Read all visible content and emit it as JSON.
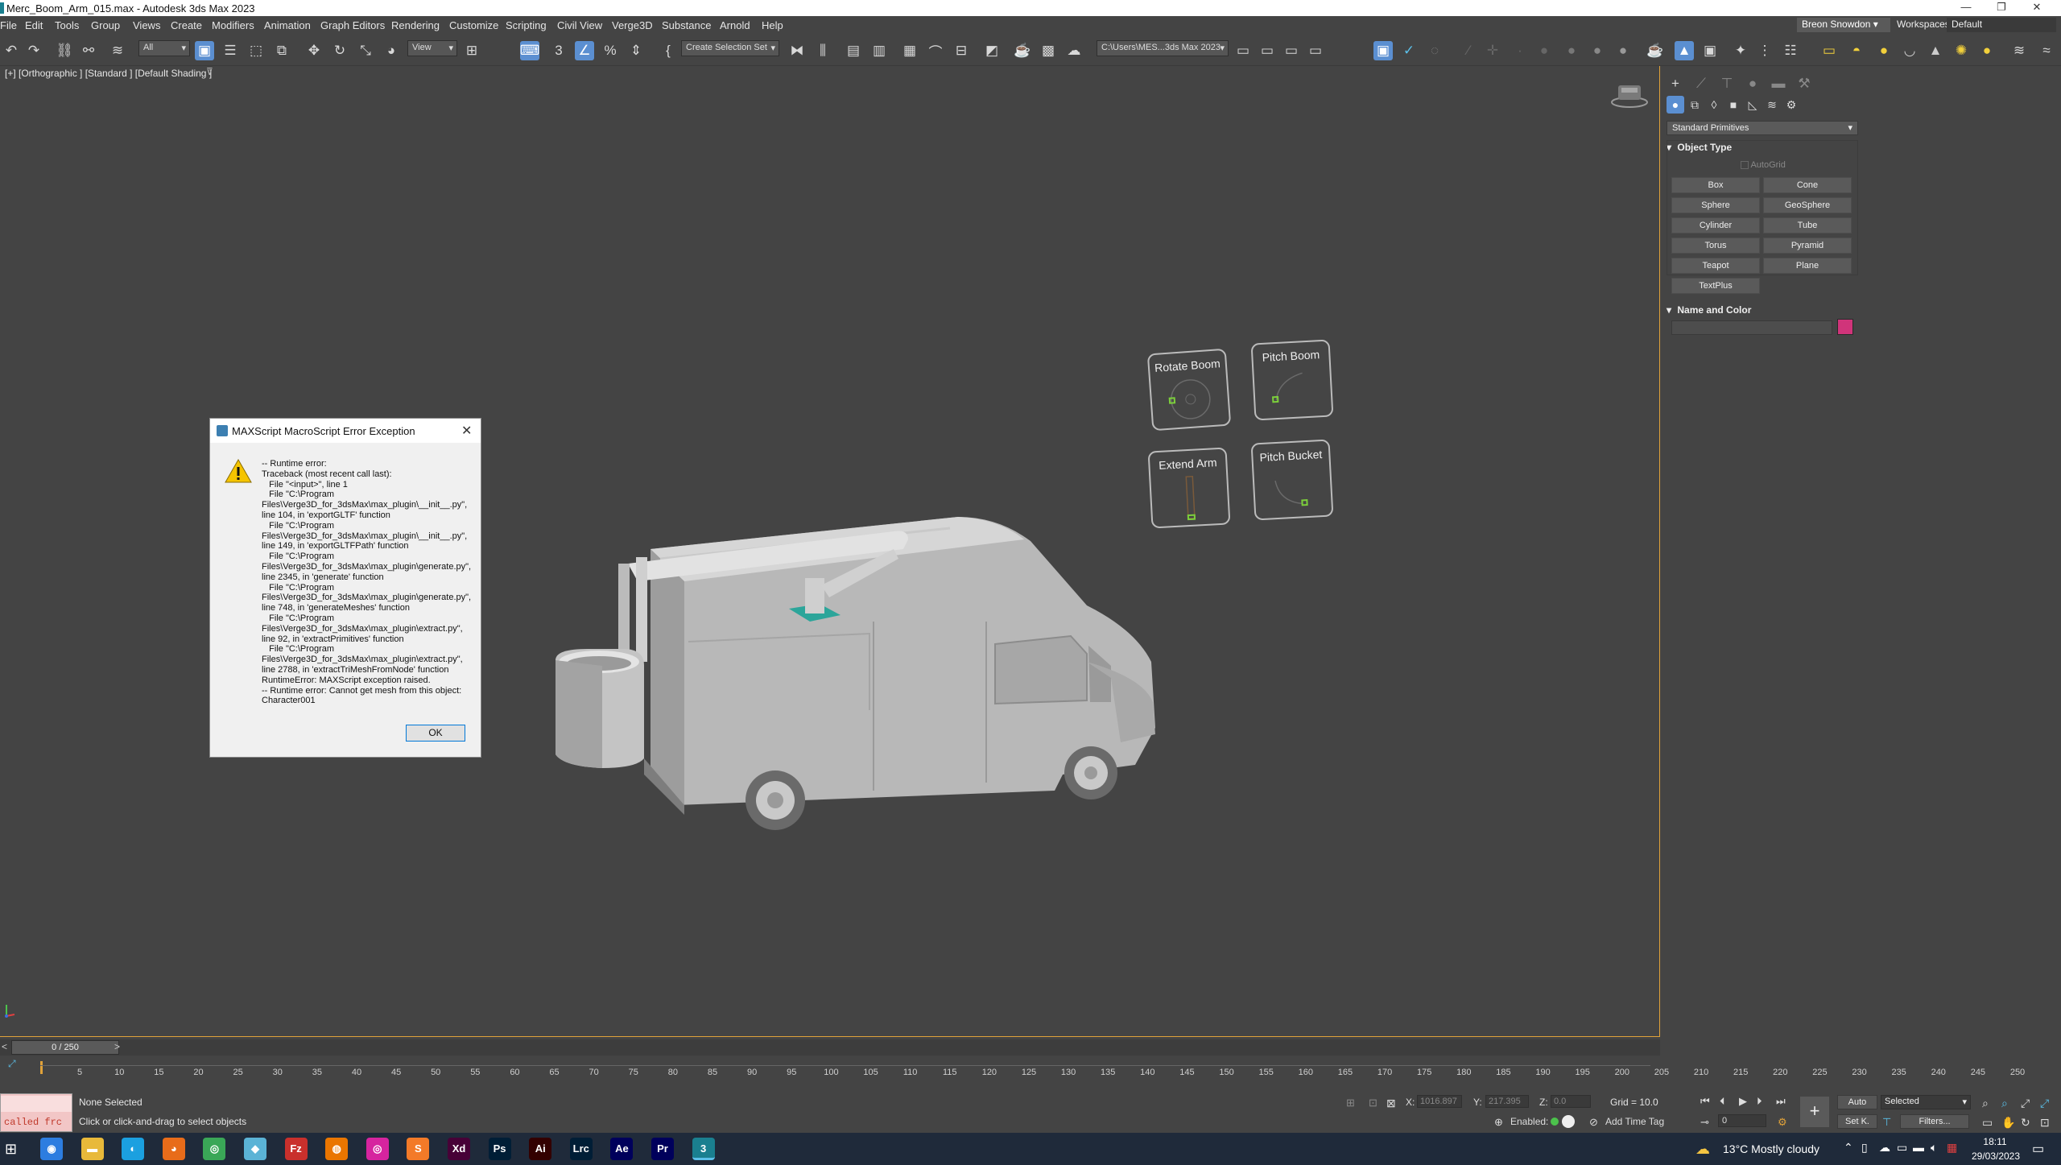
{
  "window": {
    "title": "Merc_Boom_Arm_015.max - Autodesk 3ds Max 2023"
  },
  "menu": {
    "items": [
      "File",
      "Edit",
      "Tools",
      "Group",
      "Views",
      "Create",
      "Modifiers",
      "Animation",
      "Graph Editors",
      "Rendering",
      "Customize",
      "Scripting",
      "Civil View",
      "Verge3D",
      "Substance",
      "Arnold",
      "Help"
    ],
    "user": "Breon Snowdon ▾",
    "workspaces_label": "Workspaces:",
    "workspace_value": "Default"
  },
  "toolbar": {
    "filter_value": "All",
    "ref_coord_value": "View",
    "selection_set_placeholder": "Create Selection Set",
    "project_path": "C:\\Users\\MES...3ds Max 2023"
  },
  "viewport": {
    "label": "[+] [Orthographic ] [Standard ] [Default Shading ]",
    "filter_icon": "funnel-icon"
  },
  "controls": {
    "rotate_boom": "Rotate Boom",
    "pitch_boom": "Pitch Boom",
    "extend_arm": "Extend Arm",
    "pitch_bucket": "Pitch Bucket"
  },
  "dialog": {
    "title": "MAXScript MacroScript Error Exception",
    "message": "-- Runtime error:\nTraceback (most recent call last):\n   File \"<input>\", line 1\n   File \"C:\\Program Files\\Verge3D_for_3dsMax\\max_plugin\\__init__.py\", line 104, in 'exportGLTF' function\n   File \"C:\\Program Files\\Verge3D_for_3dsMax\\max_plugin\\__init__.py\", line 149, in 'exportGLTFPath' function\n   File \"C:\\Program Files\\Verge3D_for_3dsMax\\max_plugin\\generate.py\", line 2345, in 'generate' function\n   File \"C:\\Program Files\\Verge3D_for_3dsMax\\max_plugin\\generate.py\", line 748, in 'generateMeshes' function\n   File \"C:\\Program Files\\Verge3D_for_3dsMax\\max_plugin\\extract.py\", line 92, in 'extractPrimitives' function\n   File \"C:\\Program Files\\Verge3D_for_3dsMax\\max_plugin\\extract.py\", line 2788, in 'extractTriMeshFromNode' function\nRuntimeError: MAXScript exception raised.\n-- Runtime error: Cannot get mesh from this object: Character001",
    "ok_label": "OK"
  },
  "command_panel": {
    "category_dropdown": "Standard Primitives",
    "object_type_header": "Object Type",
    "autogrid_label": "AutoGrid",
    "primitives": [
      "Box",
      "Cone",
      "Sphere",
      "GeoSphere",
      "Cylinder",
      "Tube",
      "Torus",
      "Pyramid",
      "Teapot",
      "Plane",
      "TextPlus"
    ],
    "name_color_header": "Name and Color",
    "object_color": "#d0347a"
  },
  "timeline": {
    "frame_display": "0 / 250",
    "ticks": [
      "5",
      "10",
      "15",
      "20",
      "25",
      "30",
      "35",
      "40",
      "45",
      "50",
      "55",
      "60",
      "65",
      "70",
      "75",
      "80",
      "85",
      "90",
      "95",
      "100",
      "105",
      "110",
      "115",
      "120",
      "125",
      "130",
      "135",
      "140",
      "145",
      "150",
      "155",
      "160",
      "165",
      "170",
      "175",
      "180",
      "185",
      "190",
      "195",
      "200",
      "205",
      "210",
      "215",
      "220",
      "225",
      "230",
      "235",
      "240",
      "245",
      "250"
    ]
  },
  "status": {
    "selection": "None Selected",
    "prompt": "Click or click-and-drag to select objects",
    "listener_text": "called frc",
    "x_label": "X:",
    "x_value": "1016.897",
    "y_label": "Y:",
    "y_value": "217.395",
    "z_label": "Z:",
    "z_value": "0.0",
    "grid": "Grid = 10.0",
    "enabled_label": "Enabled:",
    "add_time_tag": "Add Time Tag",
    "auto_label": "Auto",
    "selected_dropdown": "Selected",
    "set_key_label": "Set K.",
    "filters_label": "Filters...",
    "frame_input": "0"
  },
  "taskbar": {
    "apps": [
      {
        "name": "chrome-canary",
        "glyph": "◉",
        "color": "#2d7de0"
      },
      {
        "name": "file-explorer",
        "glyph": "▬",
        "color": "#e8b93a"
      },
      {
        "name": "edge",
        "glyph": "◐",
        "color": "#1ba0e0"
      },
      {
        "name": "firefox",
        "glyph": "◕",
        "color": "#e86c1a"
      },
      {
        "name": "chrome",
        "glyph": "◎",
        "color": "#3aa757"
      },
      {
        "name": "maps",
        "glyph": "◆",
        "color": "#5bb3d6"
      },
      {
        "name": "filezilla",
        "glyph": "Fz",
        "color": "#c9302c"
      },
      {
        "name": "blender",
        "glyph": "◍",
        "color": "#ea7600"
      },
      {
        "name": "instagram",
        "glyph": "◎",
        "color": "#d6249f"
      },
      {
        "name": "sublime",
        "glyph": "S",
        "color": "#f37a28"
      },
      {
        "name": "xd",
        "glyph": "Xd",
        "color": "#470137"
      },
      {
        "name": "photoshop",
        "glyph": "Ps",
        "color": "#001e36"
      },
      {
        "name": "illustrator",
        "glyph": "Ai",
        "color": "#330000"
      },
      {
        "name": "lightroom-classic",
        "glyph": "Lrc",
        "color": "#001e36"
      },
      {
        "name": "after-effects",
        "glyph": "Ae",
        "color": "#00005b"
      },
      {
        "name": "premiere",
        "glyph": "Pr",
        "color": "#00005b"
      },
      {
        "name": "3dsmax",
        "glyph": "3",
        "color": "#1a7f8f"
      }
    ],
    "weather": "13°C  Mostly cloudy",
    "time": "18:11",
    "date": "29/03/2023"
  }
}
